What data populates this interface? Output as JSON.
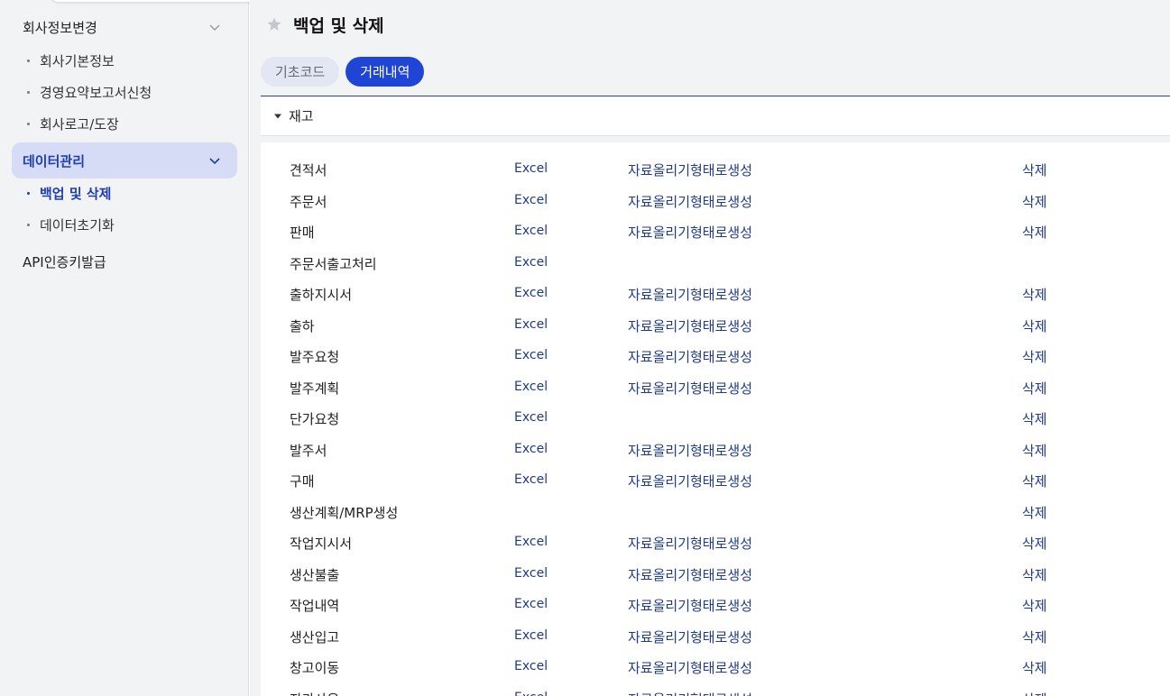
{
  "sidebar": {
    "company_group": "회사정보변경",
    "company_items": [
      "회사기본정보",
      "경영요약보고서신청",
      "회사로고/도장"
    ],
    "data_group": "데이터관리",
    "data_items": [
      "백업 및 삭제",
      "데이터초기화"
    ],
    "api_item": "API인증키발급"
  },
  "page": {
    "title": "백업 및 삭제"
  },
  "tabs": [
    "기초코드",
    "거래내역"
  ],
  "active_tab": "거래내역",
  "section": {
    "label": "재고"
  },
  "icons": {
    "star": "star-icon",
    "chevron": "chevron-down-icon",
    "caret": "caret-down-icon"
  },
  "colors": {
    "accent": "#1f45d6",
    "link": "#1f3a8a",
    "sidebar_active_bg": "#d6dcf5"
  },
  "rows": [
    {
      "name": "견적서",
      "excel": "Excel",
      "form": "자료올리기형태로생성",
      "delete": "삭제"
    },
    {
      "name": "주문서",
      "excel": "Excel",
      "form": "자료올리기형태로생성",
      "delete": "삭제"
    },
    {
      "name": "판매",
      "excel": "Excel",
      "form": "자료올리기형태로생성",
      "delete": "삭제"
    },
    {
      "name": "주문서출고처리",
      "excel": "Excel",
      "form": "",
      "delete": ""
    },
    {
      "name": "출하지시서",
      "excel": "Excel",
      "form": "자료올리기형태로생성",
      "delete": "삭제"
    },
    {
      "name": "출하",
      "excel": "Excel",
      "form": "자료올리기형태로생성",
      "delete": "삭제"
    },
    {
      "name": "발주요청",
      "excel": "Excel",
      "form": "자료올리기형태로생성",
      "delete": "삭제"
    },
    {
      "name": "발주계획",
      "excel": "Excel",
      "form": "자료올리기형태로생성",
      "delete": "삭제"
    },
    {
      "name": "단가요청",
      "excel": "Excel",
      "form": "",
      "delete": "삭제"
    },
    {
      "name": "발주서",
      "excel": "Excel",
      "form": "자료올리기형태로생성",
      "delete": "삭제"
    },
    {
      "name": "구매",
      "excel": "Excel",
      "form": "자료올리기형태로생성",
      "delete": "삭제"
    },
    {
      "name": "생산계획/MRP생성",
      "excel": "",
      "form": "",
      "delete": "삭제"
    },
    {
      "name": "작업지시서",
      "excel": "Excel",
      "form": "자료올리기형태로생성",
      "delete": "삭제"
    },
    {
      "name": "생산불출",
      "excel": "Excel",
      "form": "자료올리기형태로생성",
      "delete": "삭제"
    },
    {
      "name": "작업내역",
      "excel": "Excel",
      "form": "자료올리기형태로생성",
      "delete": "삭제"
    },
    {
      "name": "생산입고",
      "excel": "Excel",
      "form": "자료올리기형태로생성",
      "delete": "삭제"
    },
    {
      "name": "창고이동",
      "excel": "Excel",
      "form": "자료올리기형태로생성",
      "delete": "삭제"
    },
    {
      "name": "자가사용",
      "excel": "Excel",
      "form": "자료올리기형태로생성",
      "delete": "삭제"
    }
  ]
}
